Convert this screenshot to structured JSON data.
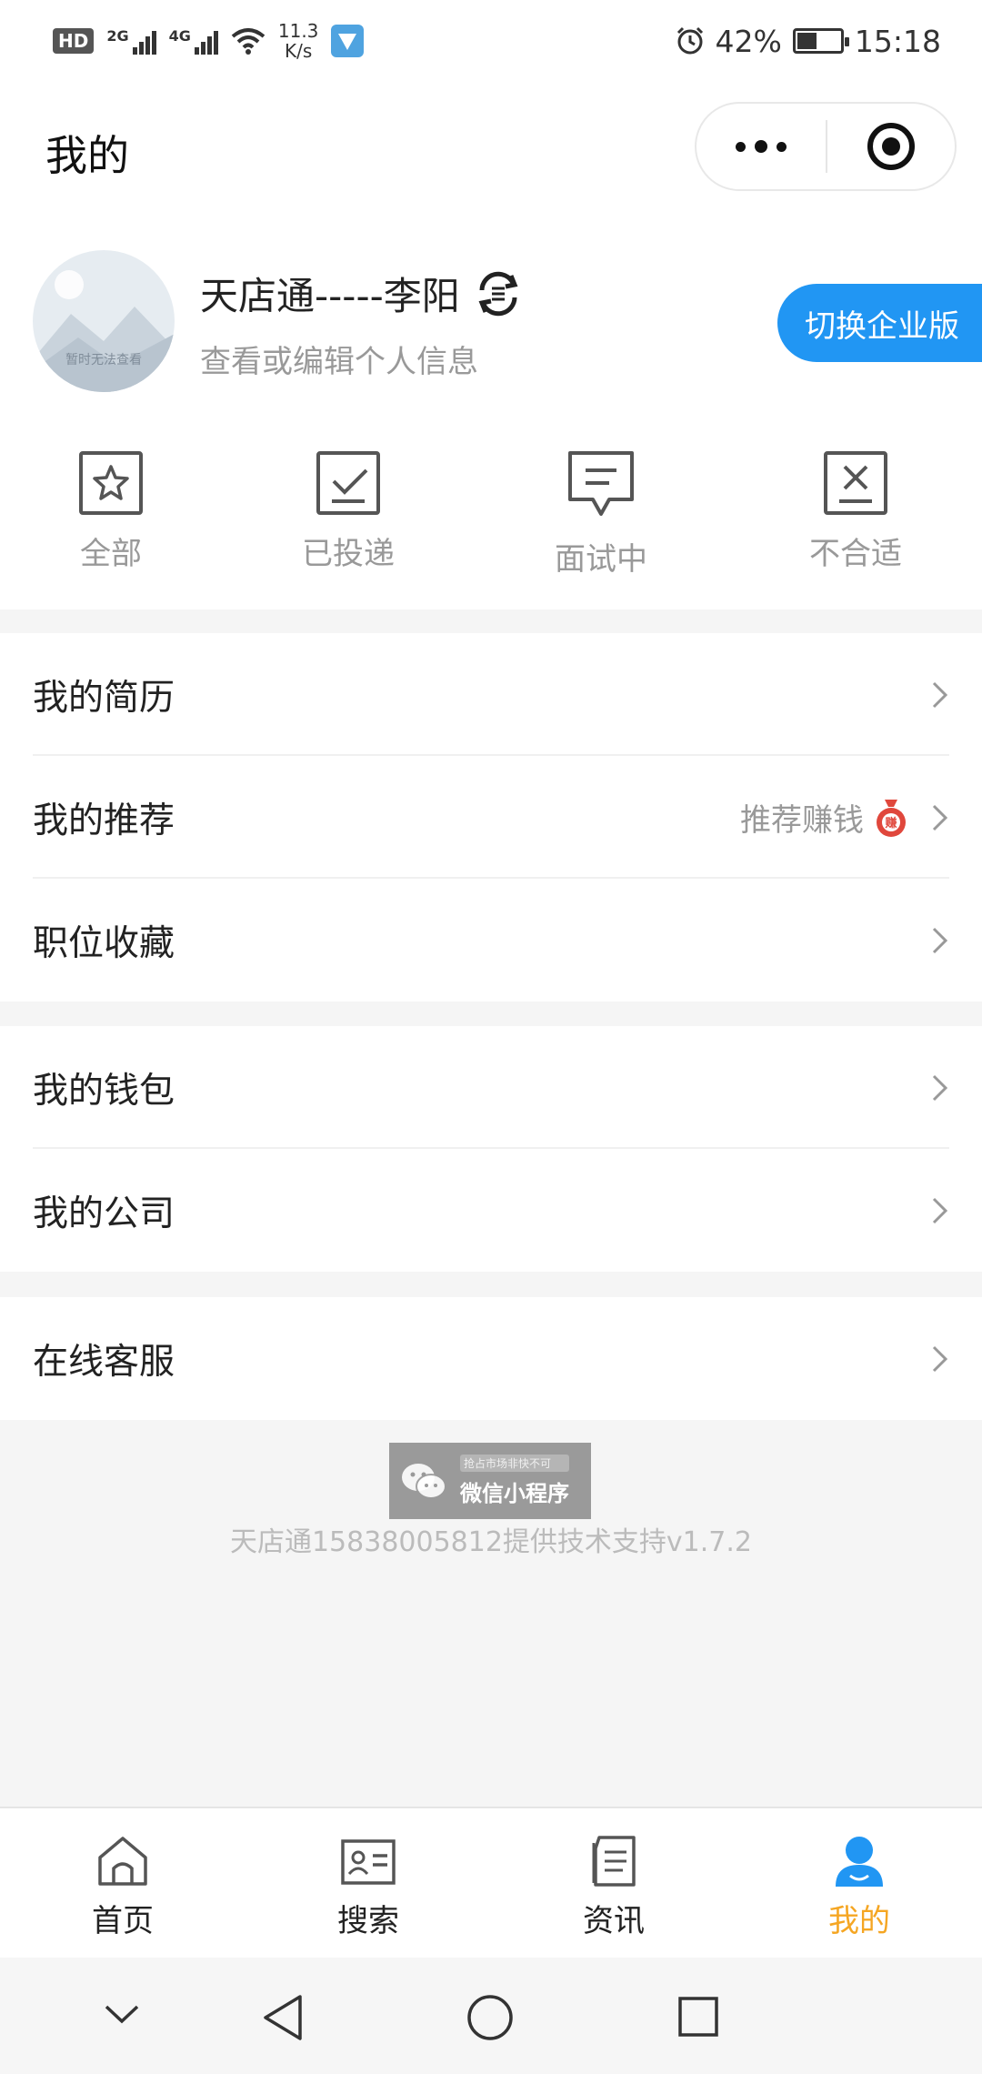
{
  "status_bar": {
    "hd": "HD",
    "net1": "2G",
    "net2": "4G",
    "speed_value": "11.3",
    "speed_unit": "K/s",
    "battery": "42%",
    "time": "15:18"
  },
  "header": {
    "title": "我的"
  },
  "profile": {
    "name": "天店通-----李阳",
    "subtitle": "查看或编辑个人信息",
    "avatar_caption": "暂时无法查看",
    "switch_label": "切换企业版"
  },
  "application_status": [
    {
      "label": "全部",
      "icon": "star-icon"
    },
    {
      "label": "已投递",
      "icon": "check-icon"
    },
    {
      "label": "面试中",
      "icon": "chat-icon"
    },
    {
      "label": "不合适",
      "icon": "x-icon"
    }
  ],
  "menu_groups": [
    [
      {
        "label": "我的简历"
      },
      {
        "label": "我的推荐",
        "extra": "推荐赚钱",
        "badge": "赚"
      },
      {
        "label": "职位收藏"
      }
    ],
    [
      {
        "label": "我的钱包"
      },
      {
        "label": "我的公司"
      }
    ],
    [
      {
        "label": "在线客服"
      }
    ]
  ],
  "footer": {
    "miniprogram_tag": "抢占市场非快不可",
    "miniprogram_label": "微信小程序",
    "support_text": "天店通15838005812提供技术支持v1.7.2"
  },
  "tabbar": {
    "items": [
      {
        "label": "首页",
        "icon": "home-icon"
      },
      {
        "label": "搜索",
        "icon": "id-card-icon"
      },
      {
        "label": "资讯",
        "icon": "document-icon"
      },
      {
        "label": "我的",
        "icon": "user-icon"
      }
    ],
    "active_index": 3
  },
  "colors": {
    "accent_blue": "#2196f3",
    "active_tab": "#f5a623",
    "badge_red": "#e0473c"
  }
}
